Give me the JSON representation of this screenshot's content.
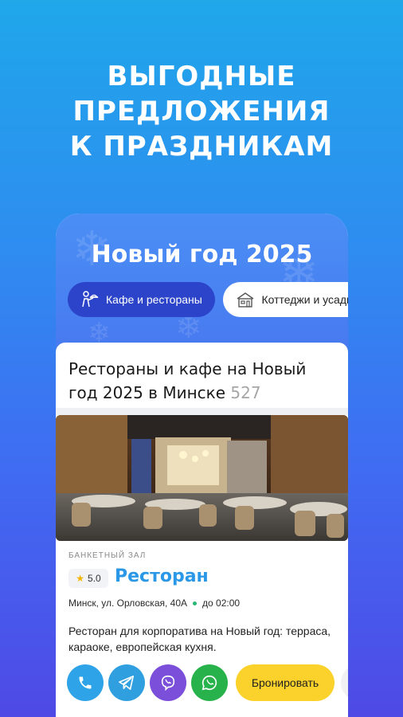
{
  "promo": {
    "line1": "ВЫГОДНЫЕ",
    "line2": "ПРЕДЛОЖЕНИЯ",
    "line3": "К ПРАЗДНИКАМ"
  },
  "hero": {
    "title": "Новый год 2025"
  },
  "chips": [
    {
      "label": "Кафе и рестораны",
      "icon": "waiter-icon",
      "active": true
    },
    {
      "label": "Коттеджи и усадьбы",
      "icon": "house-icon",
      "active": false
    }
  ],
  "section": {
    "title": "Рестораны и кафе на Новый год 2025 в Минске",
    "count": "527"
  },
  "listing": {
    "category": "БАНКЕТНЫЙ ЗАЛ",
    "rating": "5.0",
    "name": "Ресторан",
    "address": "Минск, ул. Орловская, 40А",
    "hours": "до 02:00",
    "description": "Ресторан для корпоратива на Новый год: терраса, караоке, европейская кухня.",
    "book_label": "Бронировать"
  },
  "colors": {
    "accent_blue": "#2a98e6",
    "chip_active": "#2b44c9",
    "book_yellow": "#fbd22b",
    "open_green": "#2bb673",
    "star": "#f5b400"
  }
}
